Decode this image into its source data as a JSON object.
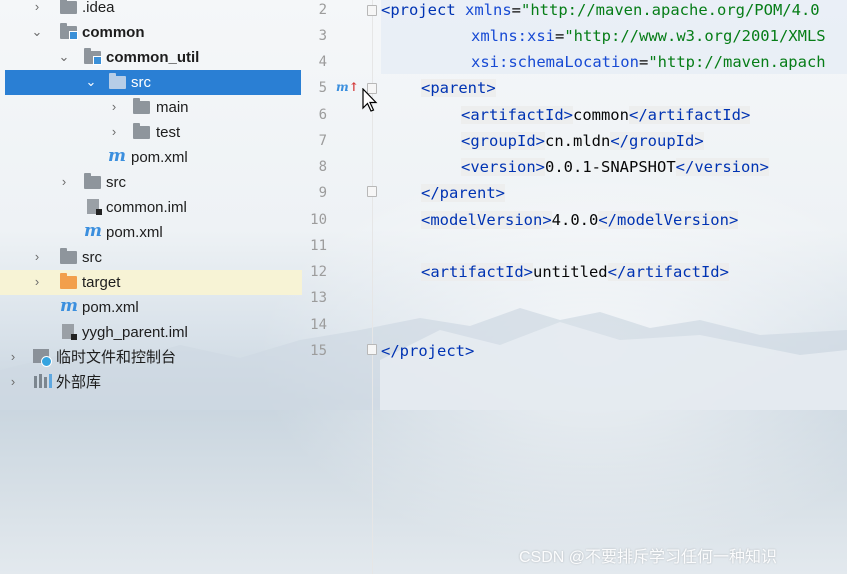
{
  "tree": [
    {
      "label": ".idea",
      "arrow": "›",
      "icon": "folder-gray"
    },
    {
      "label": "common",
      "arrow": "⌄",
      "icon": "folder-module",
      "bold": true
    },
    {
      "label": "common_util",
      "arrow": "⌄",
      "icon": "folder-module",
      "bold": true
    },
    {
      "label": "src",
      "arrow": "⌄",
      "icon": "folder-source",
      "selected": true
    },
    {
      "label": "main",
      "arrow": "›",
      "icon": "folder-gray"
    },
    {
      "label": "test",
      "arrow": "›",
      "icon": "folder-gray"
    },
    {
      "label": "pom.xml",
      "arrow": "",
      "icon": "maven-file"
    },
    {
      "label": "src",
      "arrow": "›",
      "icon": "folder-gray"
    },
    {
      "label": "common.iml",
      "arrow": "",
      "icon": "iml-file"
    },
    {
      "label": "pom.xml",
      "arrow": "",
      "icon": "maven-file"
    },
    {
      "label": "src",
      "arrow": "›",
      "icon": "folder-gray"
    },
    {
      "label": "target",
      "arrow": "›",
      "icon": "folder-excluded",
      "highlight": true
    },
    {
      "label": "pom.xml",
      "arrow": "",
      "icon": "maven-file"
    },
    {
      "label": "yygh_parent.iml",
      "arrow": "",
      "icon": "iml-file"
    },
    {
      "label": "临时文件和控制台",
      "arrow": "›",
      "icon": "scratches"
    },
    {
      "label": "外部库",
      "arrow": "›",
      "icon": "library"
    }
  ],
  "editor": {
    "line_numbers": [
      "2",
      "3",
      "4",
      "5",
      "6",
      "7",
      "8",
      "9",
      "10",
      "11",
      "12",
      "13",
      "14",
      "15"
    ],
    "implement_marker": "m",
    "lines": {
      "l2": {
        "open": "<project",
        "attr": "xmlns",
        "eq": "=",
        "val": "\"http://maven.apache.org/POM/4.0"
      },
      "l3": {
        "attr": "xmlns:xsi",
        "eq": "=",
        "val": "\"http://www.w3.org/2001/XMLS"
      },
      "l4": {
        "attr": "xsi:schemaLocation",
        "eq": "=",
        "val": "\"http://maven.apach"
      },
      "l5": {
        "open": "<parent>"
      },
      "l6": {
        "open": "<artifactId>",
        "text": "common",
        "close": "</artifactId>"
      },
      "l7": {
        "open": "<groupId>",
        "text": "cn.mldn",
        "close": "</groupId>"
      },
      "l8": {
        "open": "<version>",
        "text": "0.0.1-SNAPSHOT",
        "close": "</version>"
      },
      "l9": {
        "close": "</parent>"
      },
      "l10": {
        "open": "<modelVersion>",
        "text": "4.0.0",
        "close": "</modelVersion>"
      },
      "l12": {
        "open": "<artifactId>",
        "text": "untitled",
        "close": "</artifactId>"
      },
      "l15": {
        "close": "</project>"
      }
    }
  },
  "watermark": "CSDN @不要排斥学习任何一种知识"
}
